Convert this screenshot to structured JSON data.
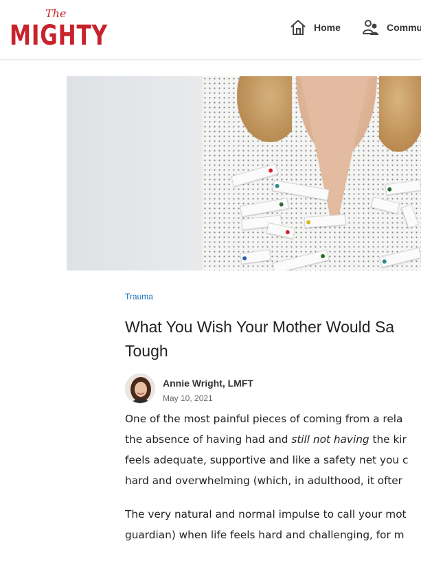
{
  "header": {
    "logo_small": "The",
    "logo_main": "MIGHTY",
    "nav": [
      {
        "label": "Home",
        "icon": "home-icon"
      },
      {
        "label": "Commu",
        "icon": "community-icon"
      }
    ]
  },
  "hero": {
    "notes": [
      "",
      "",
      "",
      "",
      "",
      "",
      "",
      "",
      "",
      "",
      "",
      ""
    ]
  },
  "article": {
    "category": "Trauma",
    "title_line1": "What You Wish Your Mother Would Sa",
    "title_line2": "Tough",
    "author": "Annie Wright, LMFT",
    "date": "May 10, 2021",
    "p1": {
      "l1": "One of the most painful pieces of coming from a rela",
      "l2a": "the absence of having had and ",
      "l2b": "still not having",
      "l2c": " the kir",
      "l3": "feels adequate, supportive and like a safety net you c",
      "l4": "hard and overwhelming (which, in adulthood, it ofter"
    },
    "p2": {
      "l1": "The very natural and normal impulse to call your mot",
      "l2": "guardian) when life feels hard and challenging, for m"
    }
  },
  "colors": {
    "brand": "#c8232c",
    "link": "#1a73b8"
  }
}
